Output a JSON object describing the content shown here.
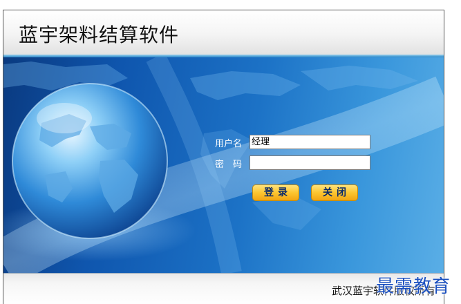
{
  "app": {
    "title": "蓝宇架料结算软件"
  },
  "login": {
    "username_label": "用户名",
    "username_value": "经理",
    "password_label": "密　码",
    "password_value": "",
    "login_button": "登录",
    "close_button": "关闭"
  },
  "footer": {
    "copyright": "武汉蓝宇软件版权所有"
  },
  "watermark": {
    "text": "最需教育"
  },
  "colors": {
    "banner_dark": "#0a3a80",
    "banner_light": "#5aaee6",
    "button_gold": "#fcc530",
    "watermark_blue": "#1a4fbf"
  },
  "icons": {
    "banner_graphic": "globe-icon"
  }
}
